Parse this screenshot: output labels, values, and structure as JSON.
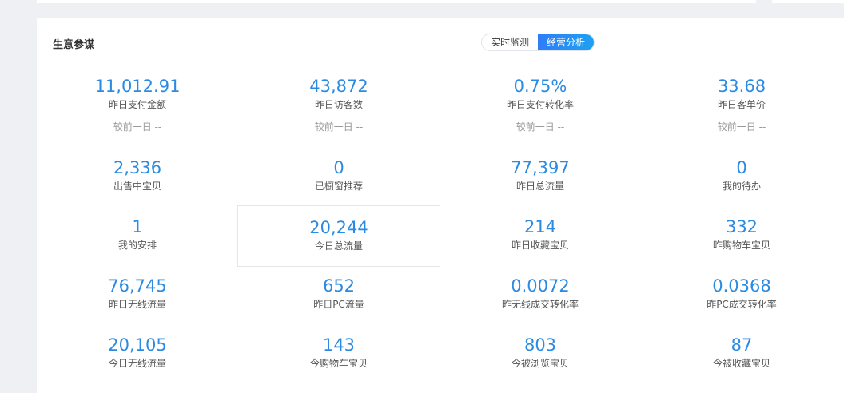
{
  "panel": {
    "title": "生意参谋",
    "toggle": {
      "realtime": "实时监测",
      "analysis": "经营分析"
    }
  },
  "metrics": [
    {
      "value": "11,012.91",
      "label": "昨日支付金额",
      "compare": "较前一日 --"
    },
    {
      "value": "43,872",
      "label": "昨日访客数",
      "compare": "较前一日 --"
    },
    {
      "value": "0.75%",
      "label": "昨日支付转化率",
      "compare": "较前一日 --"
    },
    {
      "value": "33.68",
      "label": "昨日客单价",
      "compare": "较前一日 --"
    },
    {
      "value": "2,336",
      "label": "出售中宝贝"
    },
    {
      "value": "0",
      "label": "已橱窗推荐"
    },
    {
      "value": "77,397",
      "label": "昨日总流量"
    },
    {
      "value": "0",
      "label": "我的待办"
    },
    {
      "value": "1",
      "label": "我的安排"
    },
    {
      "value": "20,244",
      "label": "今日总流量"
    },
    {
      "value": "214",
      "label": "昨日收藏宝贝"
    },
    {
      "value": "332",
      "label": "昨购物车宝贝"
    },
    {
      "value": "76,745",
      "label": "昨日无线流量"
    },
    {
      "value": "652",
      "label": "昨日PC流量"
    },
    {
      "value": "0.0072",
      "label": "昨无线成交转化率"
    },
    {
      "value": "0.0368",
      "label": "昨PC成交转化率"
    },
    {
      "value": "20,105",
      "label": "今日无线流量"
    },
    {
      "value": "143",
      "label": "今购物车宝贝"
    },
    {
      "value": "803",
      "label": "今被浏览宝贝"
    },
    {
      "value": "87",
      "label": "今被收藏宝贝"
    }
  ]
}
